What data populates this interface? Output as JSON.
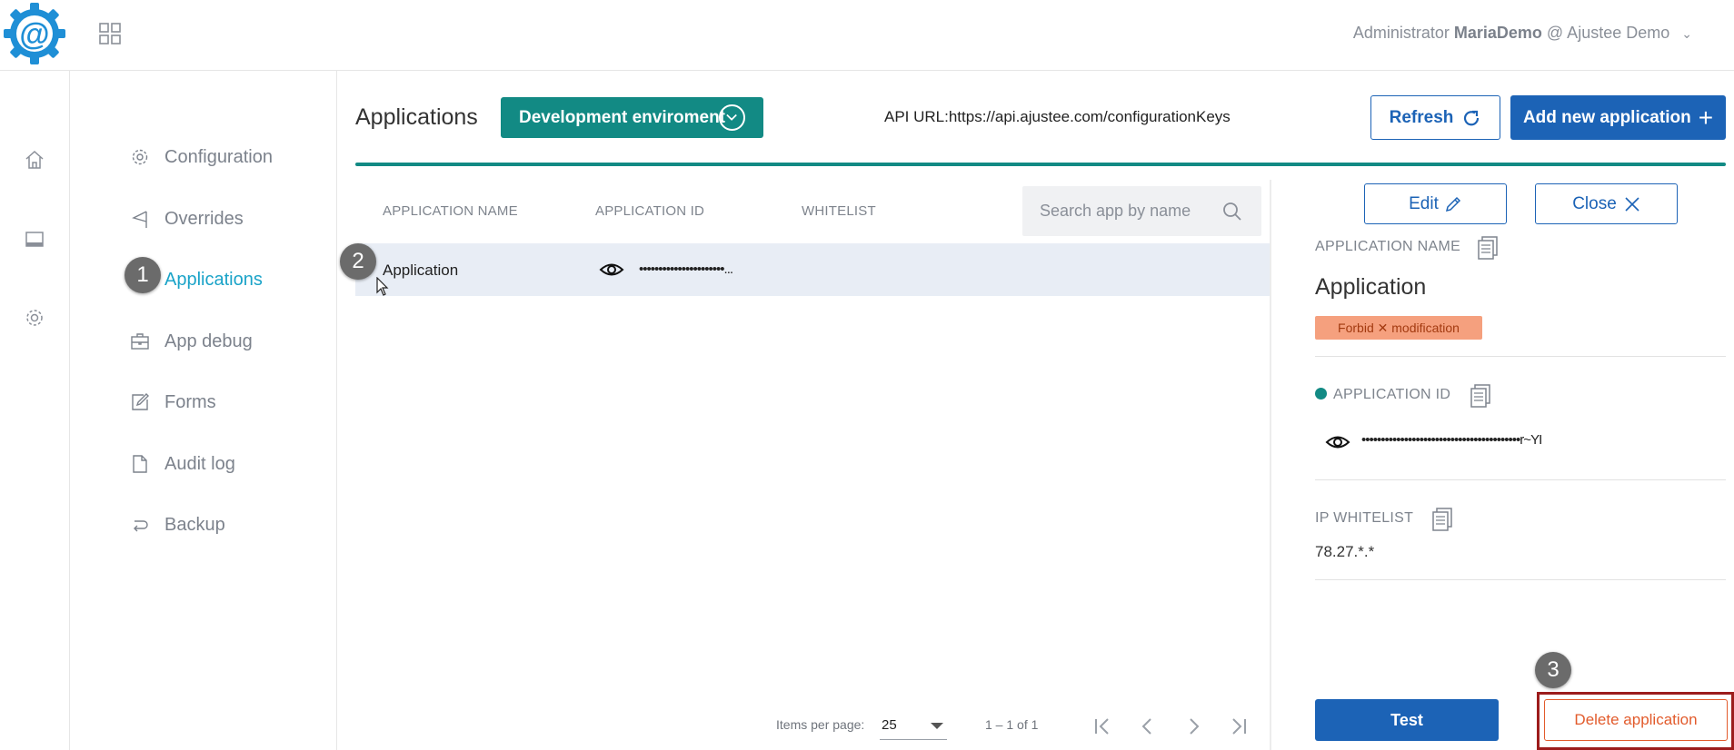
{
  "user": {
    "role": "Administrator",
    "name": "MariaDemo",
    "org": "@ Ajustee Demo"
  },
  "sidebar": {
    "items": [
      {
        "label": "Configuration",
        "icon": "gear-icon"
      },
      {
        "label": "Overrides",
        "icon": "flag-icon"
      },
      {
        "label": "Applications",
        "icon": "",
        "active": true
      },
      {
        "label": "App debug",
        "icon": "briefcase-icon"
      },
      {
        "label": "Forms",
        "icon": "edit-form-icon"
      },
      {
        "label": "Audit log",
        "icon": "document-icon"
      },
      {
        "label": "Backup",
        "icon": "backup-icon"
      }
    ]
  },
  "step_badges": [
    "1",
    "2",
    "3"
  ],
  "header": {
    "title": "Applications",
    "env_button": "Development enviroment",
    "api_url": "API URL:https://api.ajustee.com/configurationKeys",
    "refresh_label": "Refresh",
    "add_label": "Add new application"
  },
  "table": {
    "columns": [
      "APPLICATION NAME",
      "APPLICATION ID",
      "WHITELIST"
    ],
    "search_placeholder": "Search app by name",
    "rows": [
      {
        "name": "Application",
        "app_id": "••••••••••••••••••••••...",
        "whitelist": ""
      }
    ]
  },
  "pagination": {
    "items_per_page_label": "Items per page:",
    "items_per_page": "25",
    "range": "1 – 1 of 1"
  },
  "detail": {
    "edit_label": "Edit",
    "close_label": "Close",
    "name_label": "APPLICATION NAME",
    "name_value": "Application",
    "forbid_tag": "Forbid ✕ modification",
    "id_label": "APPLICATION ID",
    "id_value": "•••••••••••••••••••••••••••••••••••••••••r~YI",
    "whitelist_label": "IP WHITELIST",
    "whitelist_value": "78.27.*.*",
    "test_label": "Test",
    "delete_label": "Delete application"
  },
  "colors": {
    "teal": "#128a84",
    "blue": "#1c63b6",
    "active_nav": "#1aa3c8",
    "danger": "#e25b2c",
    "tag_bg": "#f5a07e"
  }
}
